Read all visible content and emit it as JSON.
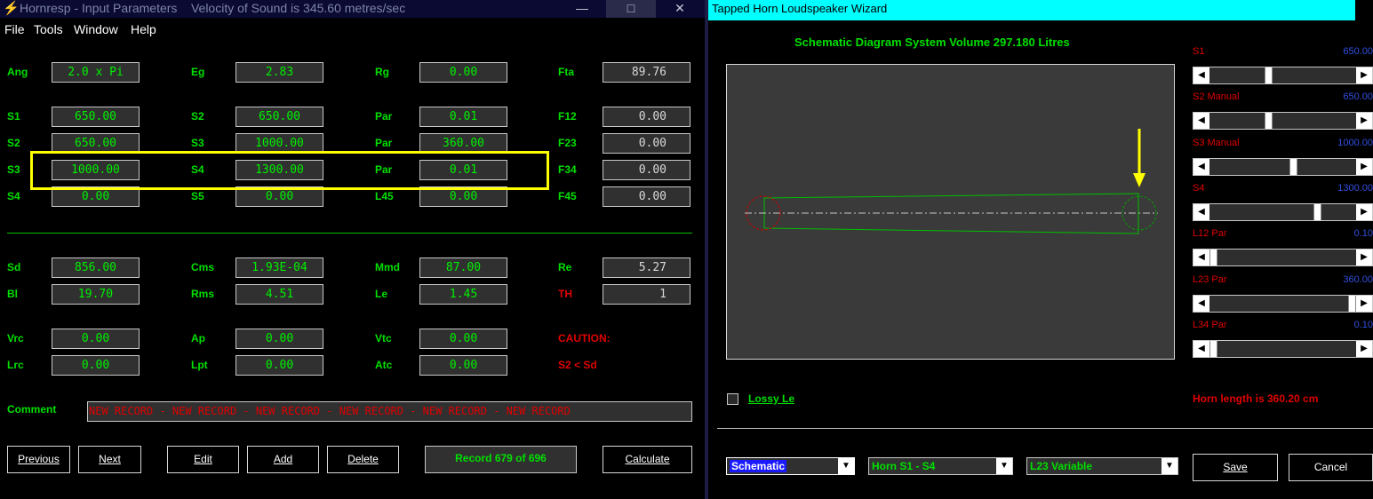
{
  "left_window": {
    "title": "Hornresp - Input Parameters",
    "subtitle": "Velocity of Sound is 345.60 metres/sec",
    "minimize": "—",
    "maximize": "□",
    "close": "✕",
    "menu": [
      "File",
      "Tools",
      "Window",
      "Help"
    ],
    "rows": [
      {
        "l1": "Ang",
        "v1": "2.0 x Pi",
        "l2": "Eg",
        "v2": "2.83",
        "l3": "Rg",
        "v3": "0.00",
        "l4": "Fta",
        "v4": "89.76"
      },
      {
        "l1": "S1",
        "v1": "650.00",
        "l2": "S2",
        "v2": "650.00",
        "l3": "Par",
        "v3": "0.01",
        "l4": "F12",
        "v4": "0.00"
      },
      {
        "l1": "S2",
        "v1": "650.00",
        "l2": "S3",
        "v2": "1000.00",
        "l3": "Par",
        "v3": "360.00",
        "l4": "F23",
        "v4": "0.00"
      },
      {
        "l1": "S3",
        "v1": "1000.00",
        "l2": "S4",
        "v2": "1300.00",
        "l3": "Par",
        "v3": "0.01",
        "l4": "F34",
        "v4": "0.00"
      },
      {
        "l1": "S4",
        "v1": "0.00",
        "l2": "S5",
        "v2": "0.00",
        "l3": "L45",
        "v3": "0.00",
        "l4": "F45",
        "v4": "0.00"
      },
      {
        "l1": "Sd",
        "v1": "856.00",
        "l2": "Cms",
        "v2": "1.93E-04",
        "l3": "Mmd",
        "v3": "87.00",
        "l4": "Re",
        "v4": "5.27"
      },
      {
        "l1": "Bl",
        "v1": "19.70",
        "l2": "Rms",
        "v2": "4.51",
        "l3": "Le",
        "v3": "1.45",
        "l4": "TH",
        "v4": "1"
      },
      {
        "l1": "Vrc",
        "v1": "0.00",
        "l2": "Ap",
        "v2": "0.00",
        "l3": "Vtc",
        "v3": "0.00",
        "l4": "CAUTION:",
        "v4": ""
      },
      {
        "l1": "Lrc",
        "v1": "0.00",
        "l2": "Lpt",
        "v2": "0.00",
        "l3": "Atc",
        "v3": "0.00",
        "l4": "S2 < Sd",
        "v4": ""
      }
    ],
    "comment_label": "Comment",
    "comment_value": "NEW RECORD - NEW RECORD - NEW RECORD - NEW RECORD - NEW RECORD - NEW RECORD",
    "buttons": {
      "previous": "Previous",
      "next": "Next",
      "edit": "Edit",
      "add": "Add",
      "delete": "Delete",
      "record": "Record 679 of 696",
      "calculate": "Calculate"
    }
  },
  "right_window": {
    "title": "Tapped Horn Loudspeaker Wizard",
    "schematic_title": "Schematic Diagram   System Volume 297.180 Litres",
    "sliders": [
      {
        "label": "S1",
        "value": "650.00",
        "position": 0.4
      },
      {
        "label": "S2 Manual",
        "value": "650.00",
        "position": 0.4
      },
      {
        "label": "S3 Manual",
        "value": "1000.00",
        "position": 0.58
      },
      {
        "label": "S4",
        "value": "1300.00",
        "position": 0.75
      },
      {
        "label": "L12 Par",
        "value": "0.10",
        "position": 0.0
      },
      {
        "label": "L23 Par",
        "value": "360.00",
        "position": 1.0
      },
      {
        "label": "L34 Par",
        "value": "0.10",
        "position": 0.0
      }
    ],
    "lossy_label": "Lossy Le",
    "horn_length": "Horn length is 360.20 cm",
    "combos": [
      {
        "value": "Schematic"
      },
      {
        "value": "Horn S1 - S4"
      },
      {
        "value": "L23 Variable"
      }
    ],
    "save": "Save",
    "cancel": "Cancel"
  },
  "colors": {
    "label_green": "#00e000",
    "label_red": "#e00000",
    "highlight_yellow": "#ffff00",
    "title_cyan": "#00ffff"
  }
}
